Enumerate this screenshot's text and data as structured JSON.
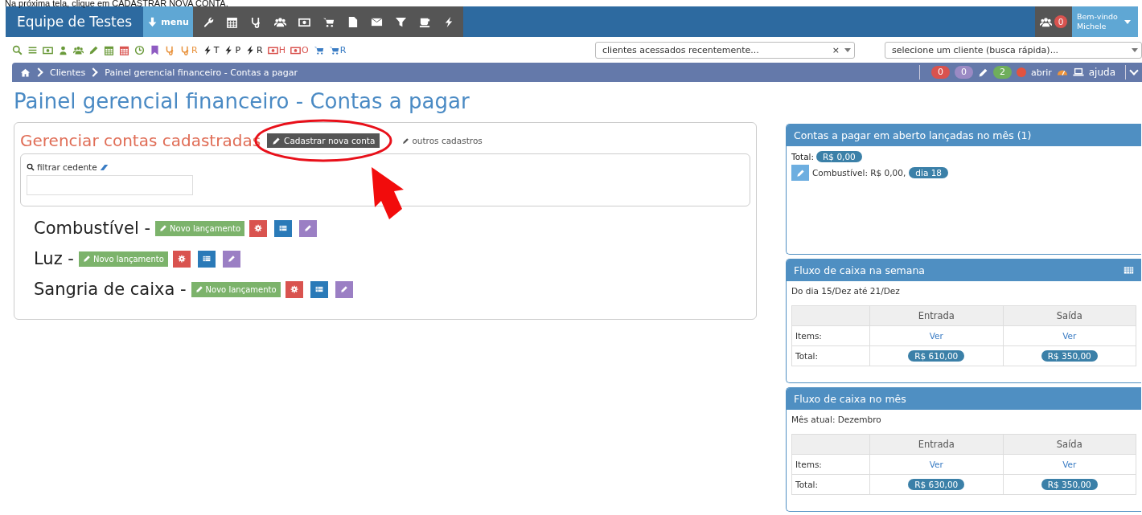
{
  "caption": "Na próxima tela, clique em CADASTRAR NOVA CONTA.",
  "navbar": {
    "brand": "Equipe de Testes",
    "menu_label": "menu",
    "tools": [
      {
        "kind": "wrench"
      },
      {
        "kind": "calendar"
      },
      {
        "kind": "stethoscope"
      },
      {
        "kind": "users"
      },
      {
        "kind": "money"
      },
      {
        "kind": "cart"
      },
      {
        "kind": "file"
      },
      {
        "kind": "envelope"
      },
      {
        "kind": "filter"
      },
      {
        "kind": "coffee"
      },
      {
        "kind": "bolt"
      }
    ],
    "notifications": "0",
    "welcome": "Bem-vindo",
    "user": "Michele"
  },
  "shortcuts": [
    {
      "kind": "search",
      "color": "#6a9a3a"
    },
    {
      "kind": "list",
      "color": "#6a9a3a"
    },
    {
      "kind": "money",
      "color": "#6a9a3a"
    },
    {
      "kind": "user",
      "color": "#6a9a3a"
    },
    {
      "kind": "users",
      "color": "#6a9a3a"
    },
    {
      "kind": "pencil",
      "color": "#6a9a3a"
    },
    {
      "kind": "calendar",
      "color": "#6a9a3a"
    },
    {
      "kind": "calendar",
      "color": "#d9534f"
    },
    {
      "kind": "clock",
      "color": "#6a9a3a"
    },
    {
      "kind": "bookmark",
      "color": "#8e5bc2"
    },
    {
      "kind": "stethoscope",
      "color": "#e8913a"
    },
    {
      "kind": "stethoscope",
      "color": "#e8913a",
      "suffix": "R"
    },
    {
      "kind": "bolt",
      "color": "#222222",
      "suffix": "T"
    },
    {
      "kind": "bolt",
      "color": "#222222",
      "suffix": "P"
    },
    {
      "kind": "bolt",
      "color": "#222222",
      "suffix": "R"
    },
    {
      "kind": "money",
      "color": "#d9534f",
      "suffix": "H"
    },
    {
      "kind": "money",
      "color": "#d9534f",
      "suffix": "O"
    },
    {
      "kind": "cart",
      "color": "#3a7cc4"
    },
    {
      "kind": "cart",
      "color": "#3a7cc4",
      "suffix": "R"
    }
  ],
  "selects": [
    {
      "placeholder": "clientes acessados recentemente...",
      "clear": "×"
    },
    {
      "placeholder": "selecione um cliente (busca rápida)..."
    }
  ],
  "breadcrumb": {
    "items": [
      "Clientes",
      "Painel gerencial financeiro - Contas a pagar"
    ],
    "badges": [
      {
        "text": "0",
        "color": "#d9534f"
      },
      {
        "text": "0",
        "color": "#9b8ac4"
      },
      {
        "text": "2",
        "color": "#6fae5c"
      }
    ],
    "open_label": "abrir",
    "help_label": "ajuda"
  },
  "page_title": "Painel gerencial financeiro - Contas a pagar",
  "accounts_panel": {
    "title": "Gerenciar contas cadastradas",
    "new_button": "Cadastrar nova conta",
    "other_link": "outros cadastros",
    "filter_label": "filtrar cedente",
    "accounts": [
      {
        "name": "Combustível -",
        "button": "Novo lançamento"
      },
      {
        "name": "Luz -",
        "button": "Novo lançamento"
      },
      {
        "name": "Sangria de caixa -",
        "button": "Novo lançamento"
      }
    ]
  },
  "open_bills": {
    "title": "Contas a pagar em aberto lançadas no mês (1)",
    "total_label": "Total:",
    "total": "R$ 0,00",
    "items": [
      {
        "text": "Combustível: R$ 0,00,",
        "due": "dia 18"
      }
    ]
  },
  "cash_flows": [
    {
      "title": "Fluxo de caixa na semana",
      "grid_icon": true,
      "subtitle": "Do dia 15/Dez até 21/Dez",
      "columns": [
        "Entrada",
        "Saída"
      ],
      "rows": [
        {
          "label": "Items:",
          "kind": "link",
          "cells": [
            "Ver",
            "Ver"
          ]
        },
        {
          "label": "Total:",
          "kind": "badge",
          "cells": [
            "R$ 610,00",
            "R$ 350,00"
          ]
        }
      ]
    },
    {
      "title": "Fluxo de caixa no mês",
      "grid_icon": false,
      "subtitle": "Mês atual: Dezembro",
      "columns": [
        "Entrada",
        "Saída"
      ],
      "rows": [
        {
          "label": "Items:",
          "kind": "link",
          "cells": [
            "Ver",
            "Ver"
          ]
        },
        {
          "label": "Total:",
          "kind": "badge",
          "cells": [
            "R$ 630,00",
            "R$ 350,00"
          ]
        }
      ]
    }
  ]
}
